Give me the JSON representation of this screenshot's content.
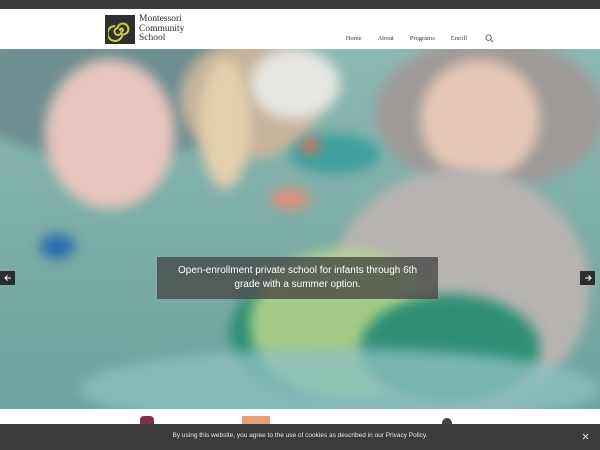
{
  "site": {
    "name_line1": "Montessori",
    "name_line2": "Community",
    "name_line3": "School"
  },
  "nav": {
    "home": "Home",
    "about": "About",
    "programs": "Programs",
    "enroll": "Enroll"
  },
  "hero": {
    "caption_line1": "Open-enrollment private school for infants through 6th",
    "caption_line2": "grade with a summer option.",
    "slide_count": 1,
    "active_slide": 1
  },
  "cookie": {
    "text": "By using this website, you agree to the use of cookies as described in our Privacy Policy."
  },
  "colors": {
    "topbar": "#3a3a3a",
    "logo_accent": "#c8d23c",
    "cookie_bar": "#3b3b3b"
  },
  "icons": [
    "logo-spiral-icon",
    "search-icon",
    "arrow-left-icon",
    "arrow-right-icon",
    "close-icon"
  ]
}
